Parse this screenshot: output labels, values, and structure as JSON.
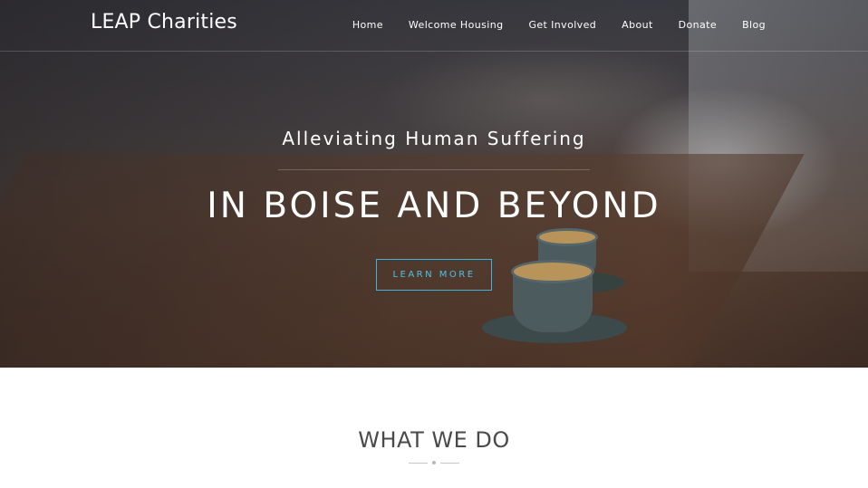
{
  "header": {
    "brand": "LEAP Charities",
    "nav": [
      "Home",
      "Welcome Housing",
      "Get Involved",
      "About",
      "Donate",
      "Blog"
    ]
  },
  "hero": {
    "tagline": "Alleviating Human Suffering",
    "headline": "IN BOISE AND BEYOND",
    "cta_label": "LEARN MORE"
  },
  "section": {
    "title": "WHAT WE DO"
  },
  "colors": {
    "accent": "#3fb4d6",
    "heading": "#4a4a4a"
  }
}
